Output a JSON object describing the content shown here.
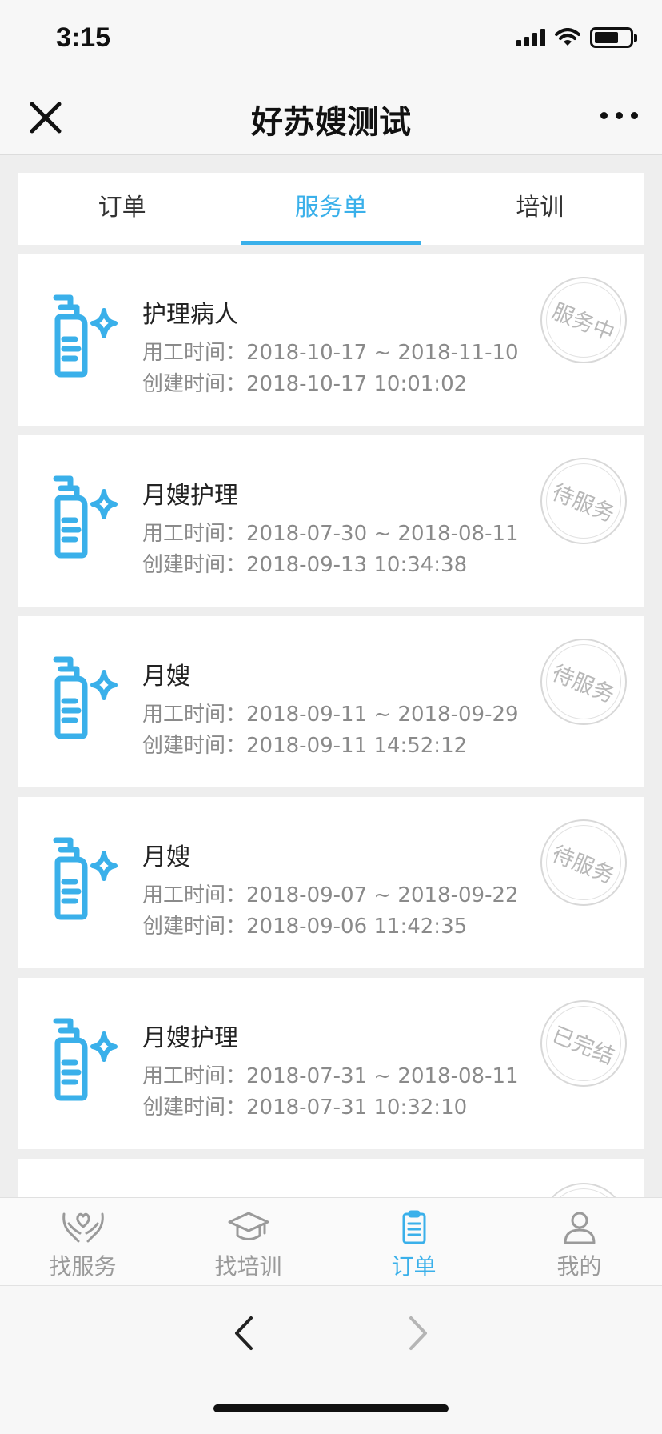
{
  "status_bar": {
    "time": "3:15"
  },
  "nav": {
    "title": "好苏嫂测试"
  },
  "tabs": [
    {
      "label": "订单",
      "active": false
    },
    {
      "label": "服务单",
      "active": true
    },
    {
      "label": "培训",
      "active": false
    }
  ],
  "orders": [
    {
      "title": "护理病人",
      "work_label": "用工时间：",
      "work_time": "2018-10-17 ~ 2018-11-10",
      "created_label": "创建时间：",
      "created_time": "2018-10-17 10:01:02",
      "status": "服务中"
    },
    {
      "title": "月嫂护理",
      "work_label": "用工时间：",
      "work_time": "2018-07-30 ~ 2018-08-11",
      "created_label": "创建时间：",
      "created_time": "2018-09-13 10:34:38",
      "status": "待服务"
    },
    {
      "title": "月嫂",
      "work_label": "用工时间：",
      "work_time": "2018-09-11 ~ 2018-09-29",
      "created_label": "创建时间：",
      "created_time": "2018-09-11 14:52:12",
      "status": "待服务"
    },
    {
      "title": "月嫂",
      "work_label": "用工时间：",
      "work_time": "2018-09-07 ~ 2018-09-22",
      "created_label": "创建时间：",
      "created_time": "2018-09-06 11:42:35",
      "status": "待服务"
    },
    {
      "title": "月嫂护理",
      "work_label": "用工时间：",
      "work_time": "2018-07-31 ~ 2018-08-11",
      "created_label": "创建时间：",
      "created_time": "2018-07-31 10:32:10",
      "status": "已完结"
    }
  ],
  "tab_bar": [
    {
      "label": "找服务",
      "icon": "heart-hands-icon",
      "active": false
    },
    {
      "label": "找培训",
      "icon": "graduation-cap-icon",
      "active": false
    },
    {
      "label": "订单",
      "icon": "clipboard-icon",
      "active": true
    },
    {
      "label": "我的",
      "icon": "user-icon",
      "active": false
    }
  ],
  "colors": {
    "accent": "#3ab0ea",
    "muted": "#9a9a9a",
    "stamp": "#b8b8b8"
  }
}
